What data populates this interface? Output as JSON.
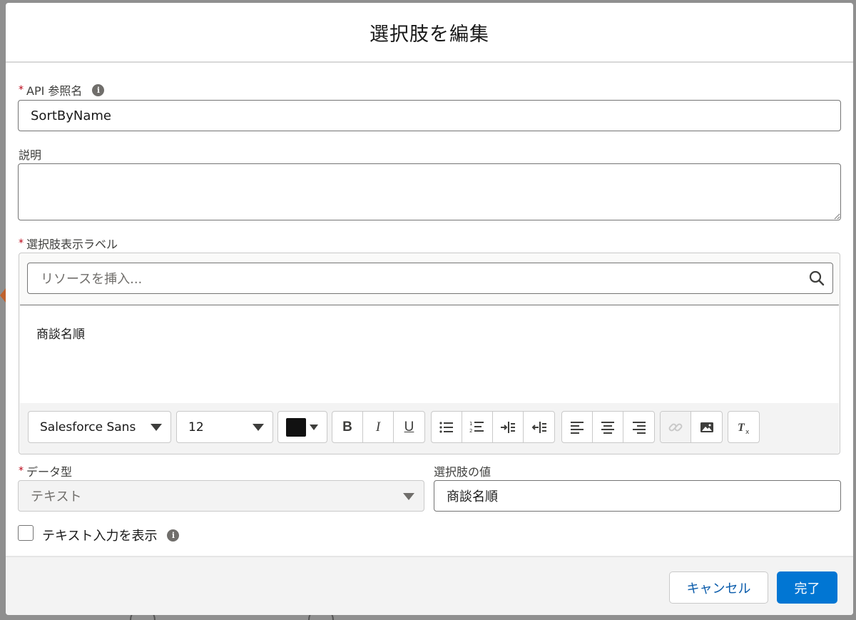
{
  "modal": {
    "title": "選択肢を編集"
  },
  "api_name": {
    "label": "API 参照名",
    "required_mark": "*",
    "value": "SortByName"
  },
  "description": {
    "label": "説明",
    "value": ""
  },
  "choice_label": {
    "label": "選択肢表示ラベル",
    "required_mark": "*",
    "resource_placeholder": "リソースを挿入...",
    "editor_content": "商談名順"
  },
  "toolbar": {
    "font_family": "Salesforce Sans",
    "font_size": "12",
    "color": "#111111",
    "bold": "B",
    "italic": "I",
    "underline": "U"
  },
  "data_type": {
    "label": "データ型",
    "required_mark": "*",
    "value": "テキスト"
  },
  "choice_value": {
    "label": "選択肢の値",
    "value": "商談名順"
  },
  "show_text_input": {
    "label": "テキスト入力を表示",
    "checked": false
  },
  "footer": {
    "cancel_label": "キャンセル",
    "done_label": "完了"
  },
  "colors": {
    "brand": "#0176d3",
    "required": "#ba0517"
  }
}
